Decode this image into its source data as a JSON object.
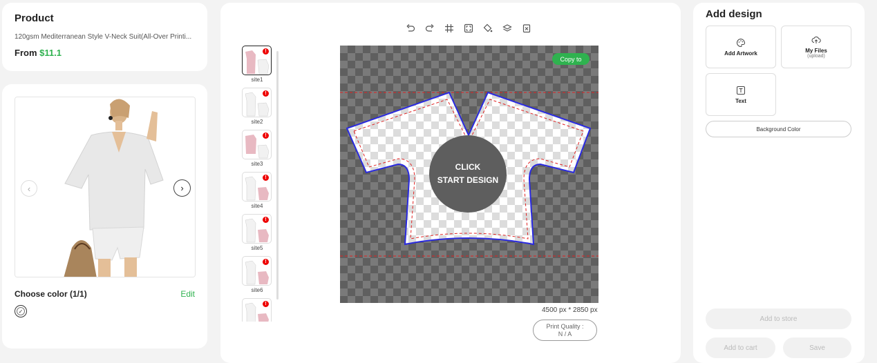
{
  "product": {
    "heading": "Product",
    "name": "120gsm Mediterranean Style V-Neck Suit(All-Over Printi...",
    "price_prefix": "From",
    "price": "$11.1"
  },
  "preview": {
    "prev_icon": "chevron-left-icon",
    "next_icon": "chevron-right-icon",
    "choose_color_label": "Choose color  (1/1)",
    "edit_label": "Edit"
  },
  "toolbar": {
    "icons": [
      "undo-icon",
      "redo-icon",
      "grid-icon",
      "fit-screen-icon",
      "fill-icon",
      "layers-icon",
      "delete-icon"
    ]
  },
  "sites": [
    {
      "label": "site1",
      "badge": "!",
      "active": true
    },
    {
      "label": "site2",
      "badge": "!",
      "active": false
    },
    {
      "label": "site3",
      "badge": "!",
      "active": false
    },
    {
      "label": "site4",
      "badge": "!",
      "active": false
    },
    {
      "label": "site5",
      "badge": "!",
      "active": false
    },
    {
      "label": "site6",
      "badge": "!",
      "active": false
    },
    {
      "label": "",
      "badge": "!",
      "active": false
    }
  ],
  "canvas": {
    "copy_label": "Copy to",
    "start_line1": "CLICK",
    "start_line2": "START DESIGN",
    "dimensions": "4500 px * 2850 px",
    "quality_line1": "Print Quality :",
    "quality_line2": "N / A"
  },
  "right_panel": {
    "heading": "Add design",
    "tiles": {
      "artwork": "Add Artwork",
      "my_files": "My Files",
      "my_files_sub": "(upload)",
      "text": "Text"
    },
    "background_color": "Background Color",
    "add_to_store": "Add to store",
    "add_to_cart": "Add to cart",
    "save": "Save"
  },
  "colors": {
    "accent": "#2fb24f",
    "badge": "#e00000",
    "outline": "#2a2ae0",
    "safe_line": "#e02020"
  }
}
